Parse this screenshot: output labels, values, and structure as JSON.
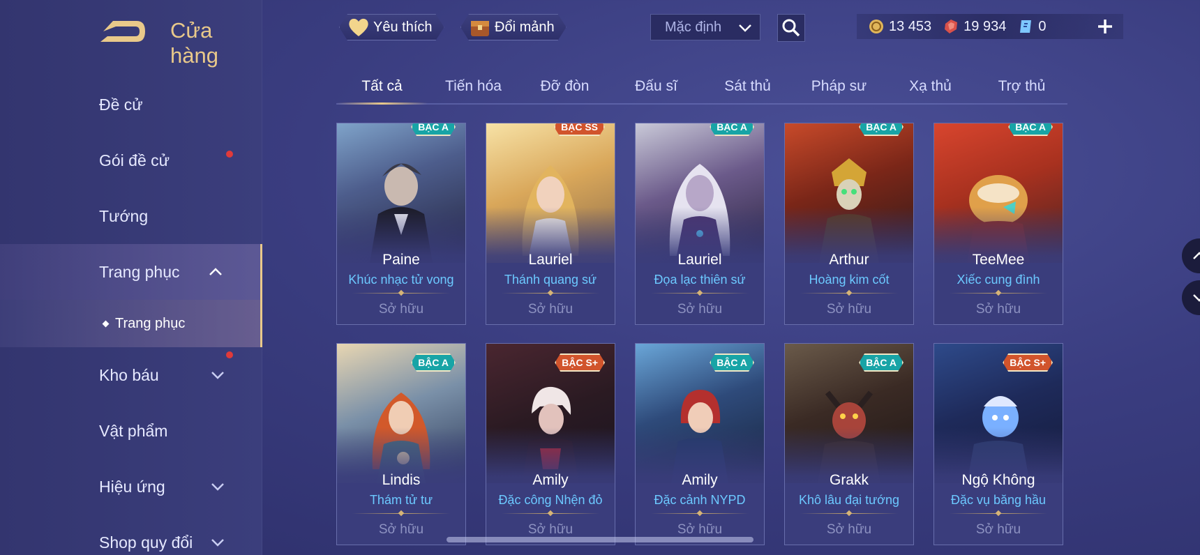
{
  "header": {
    "title": "Cửa hàng",
    "favorites_label": "Yêu thích",
    "exchange_label": "Đổi mảnh",
    "sort_value": "Mặc định"
  },
  "currencies": [
    {
      "icon": "gold-coin-icon",
      "value": "13 453"
    },
    {
      "icon": "red-gem-icon",
      "value": "19 934"
    },
    {
      "icon": "blue-voucher-icon",
      "value": "0"
    }
  ],
  "sidebar": {
    "items": [
      {
        "label": "Đề cử"
      },
      {
        "label": "Gói đề cử"
      },
      {
        "label": "Tướng"
      },
      {
        "label": "Trang phục"
      },
      {
        "label": "Kho báu"
      },
      {
        "label": "Vật phẩm"
      },
      {
        "label": "Hiệu ứng"
      },
      {
        "label": "Shop quy đổi"
      }
    ],
    "sub_item": "Trang phục"
  },
  "tabs": [
    "Tất cả",
    "Tiến hóa",
    "Đỡ đòn",
    "Đấu sĩ",
    "Sát thủ",
    "Pháp sư",
    "Xạ thủ",
    "Trợ thủ"
  ],
  "cards": [
    {
      "hero": "Paine",
      "skin": "Khúc nhạc tử vong",
      "status": "Sở hữu",
      "tier": "BẬC A"
    },
    {
      "hero": "Lauriel",
      "skin": "Thánh quang sứ",
      "status": "Sở hữu",
      "tier": "BẬC SS"
    },
    {
      "hero": "Lauriel",
      "skin": "Đọa lạc thiên sứ",
      "status": "Sở hữu",
      "tier": "BẬC A"
    },
    {
      "hero": "Arthur",
      "skin": "Hoàng kim cốt",
      "status": "Sở hữu",
      "tier": "BẬC A"
    },
    {
      "hero": "TeeMee",
      "skin": "Xiếc cung đình",
      "status": "Sở hữu",
      "tier": "BẬC A"
    },
    {
      "hero": "Lindis",
      "skin": "Thám tử tư",
      "status": "Sở hữu",
      "tier": "BẬC A"
    },
    {
      "hero": "Amily",
      "skin": "Đặc công Nhện đỏ",
      "status": "Sở hữu",
      "tier": "BẬC S+"
    },
    {
      "hero": "Amily",
      "skin": "Đặc cảnh NYPD",
      "status": "Sở hữu",
      "tier": "BẬC A"
    },
    {
      "hero": "Grakk",
      "skin": "Khô lâu đại tướng",
      "status": "Sở hữu",
      "tier": "BẬC A"
    },
    {
      "hero": "Ngộ Không",
      "skin": "Đặc vụ băng hầu",
      "status": "Sở hữu",
      "tier": "BẬC S+"
    }
  ],
  "colors": {
    "accent_gold": "#e9c98a",
    "skin_name_blue": "#6cc9ff",
    "badge_a": "#18a4a6",
    "badge_s": "#d1542c",
    "notification_red": "#e03a3a"
  }
}
